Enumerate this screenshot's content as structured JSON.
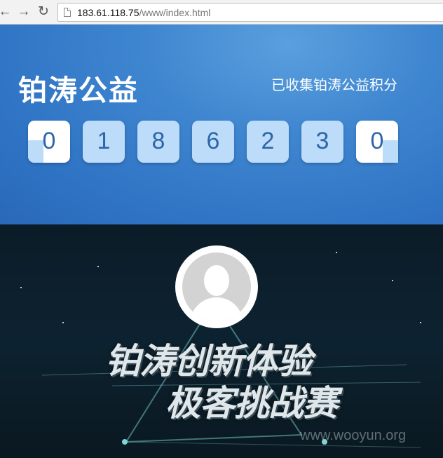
{
  "browser": {
    "url_host": "183.61.118.75",
    "url_path": "/www/index.html"
  },
  "banner": {
    "brand": "铂涛公益",
    "collected_label": "已收集铂涛公益积分",
    "digits": [
      "0",
      "1",
      "8",
      "6",
      "2",
      "3",
      "0"
    ]
  },
  "hero": {
    "title_line1": "铂涛创新体验",
    "title_line2": "极客挑战赛",
    "watermark": "www.wooyun.org"
  }
}
